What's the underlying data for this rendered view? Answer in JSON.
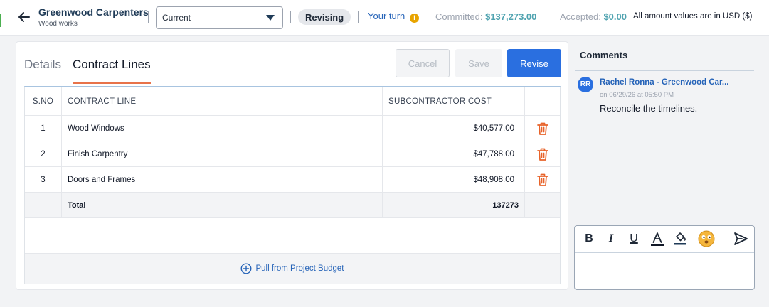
{
  "header": {
    "vendor_name": "Greenwood Carpenters",
    "vendor_sub": "Wood works",
    "version_select": "Current",
    "status": "Revising",
    "turn": "Your turn",
    "turn_icon": "i",
    "committed_label": "Committed:",
    "committed_value": "$137,273.00",
    "accepted_label": "Accepted:",
    "accepted_value": "$0.00",
    "currency_note": "All amount values are in USD ($)"
  },
  "tabs": {
    "details": "Details",
    "contract_lines": "Contract Lines"
  },
  "actions": {
    "cancel": "Cancel",
    "save": "Save",
    "revise": "Revise"
  },
  "table": {
    "columns": {
      "sno": "S.NO",
      "line": "CONTRACT LINE",
      "cost": "SUBCONTRACTOR COST"
    },
    "rows": [
      {
        "sno": "1",
        "line": "Wood Windows",
        "cost": "$40,577.00"
      },
      {
        "sno": "2",
        "line": "Finish Carpentry",
        "cost": "$47,788.00"
      },
      {
        "sno": "3",
        "line": "Doors and Frames",
        "cost": "$48,908.00"
      }
    ],
    "total_label": "Total",
    "total_value": "137273",
    "pull_link": "Pull from Project Budget"
  },
  "comments": {
    "title": "Comments",
    "items": [
      {
        "initials": "RR",
        "author": "Rachel Ronna - Greenwood Car...",
        "time": "on 06/29/26 at 05:50 PM",
        "text": "Reconcile the timelines."
      }
    ],
    "toolbar": {
      "bold": "B",
      "italic": "I",
      "underline": "U",
      "text_color": "A"
    }
  },
  "colors": {
    "primary": "#2a6fe0",
    "accent_tab": "#e8734a",
    "amount_teal": "#4fa3b0",
    "delete_icon": "#e8632a",
    "info_badge": "#e8a400"
  },
  "icons": {
    "back": "arrow-left-icon",
    "dropdown": "caret-down-icon",
    "info": "info-icon",
    "delete": "trash-icon",
    "pull": "plus-circle-icon",
    "text_color": "text-color-icon",
    "fill": "fill-color-icon",
    "emoji": "emoji-icon",
    "send": "send-icon"
  }
}
